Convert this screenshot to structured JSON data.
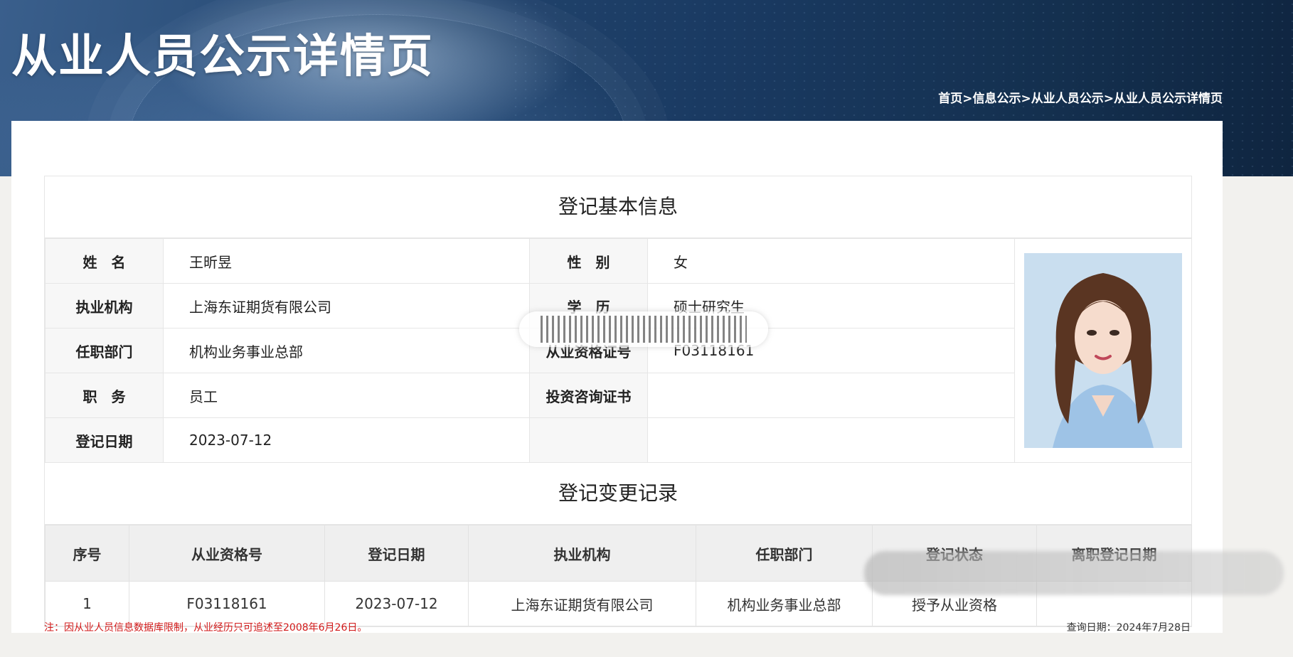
{
  "header": {
    "title": "从业人员公示详情页",
    "breadcrumb": [
      "首页",
      "信息公示",
      "从业人员公示",
      "从业人员公示详情页"
    ],
    "breadcrumb_sep": ">"
  },
  "basic_info": {
    "section_title": "登记基本信息",
    "rows": [
      {
        "label1": "姓　名",
        "value1": "王昕昱",
        "label2": "性　别",
        "value2": "女"
      },
      {
        "label1": "执业机构",
        "value1": "上海东证期货有限公司",
        "label2": "学　历",
        "value2": "硕士研究生"
      },
      {
        "label1": "任职部门",
        "value1": "机构业务事业总部",
        "label2": "从业资格证号",
        "value2": "F03118161"
      },
      {
        "label1": "职　务",
        "value1": "员工",
        "label2": "投资咨询证书",
        "value2": ""
      },
      {
        "label1": "登记日期",
        "value1": "2023-07-12",
        "label2": "",
        "value2": ""
      }
    ]
  },
  "change_log": {
    "section_title": "登记变更记录",
    "columns": [
      "序号",
      "从业资格号",
      "登记日期",
      "执业机构",
      "任职部门",
      "登记状态",
      "离职登记日期"
    ],
    "rows": [
      [
        "1",
        "F03118161",
        "2023-07-12",
        "上海东证期货有限公司",
        "机构业务事业总部",
        "授予从业资格",
        ""
      ]
    ]
  },
  "footer": {
    "note": "注：因从业人员信息数据库限制，从业经历只可追述至2008年6月26日。",
    "query_date": "查询日期：2024年7月28日"
  }
}
